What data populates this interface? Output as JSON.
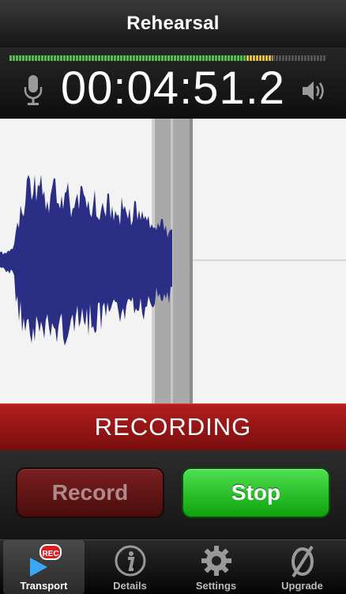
{
  "title": "Rehearsal",
  "timer": "00:04:51.2",
  "status": "RECORDING",
  "buttons": {
    "record": "Record",
    "stop": "Stop"
  },
  "meter": {
    "green_fraction": 0.75,
    "yellow_fraction": 0.08
  },
  "tabs": [
    {
      "label": "Transport",
      "icon": "transport-rec-icon",
      "badge": "REC",
      "active": true
    },
    {
      "label": "Details",
      "icon": "info-icon",
      "active": false
    },
    {
      "label": "Settings",
      "icon": "gear-icon",
      "active": false
    },
    {
      "label": "Upgrade",
      "icon": "upgrade-icon",
      "active": false
    }
  ],
  "colors": {
    "waveform": "#2a2e85",
    "status_red": "#a11616",
    "stop_green": "#1fba1f"
  }
}
